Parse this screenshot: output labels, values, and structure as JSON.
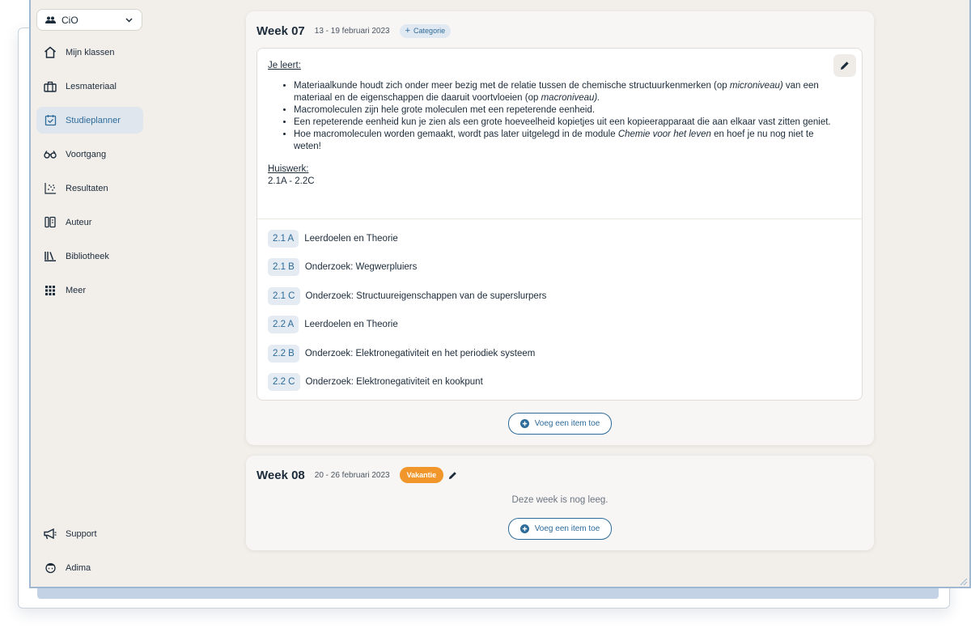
{
  "colors": {
    "accent": "#2d6b9a",
    "vacation": "#f0962a",
    "app_bg": "#f2efeb"
  },
  "sidebar": {
    "org_selector": {
      "label": "CiO",
      "icon": "people-icon"
    },
    "items": [
      {
        "label": "Mijn klassen",
        "icon": "home-icon"
      },
      {
        "label": "Lesmateriaal",
        "icon": "briefcase-icon"
      },
      {
        "label": "Studieplanner",
        "icon": "calendar-check-icon",
        "active": true
      },
      {
        "label": "Voortgang",
        "icon": "glasses-icon"
      },
      {
        "label": "Resultaten",
        "icon": "scatter-icon"
      },
      {
        "label": "Auteur",
        "icon": "book-author-icon"
      },
      {
        "label": "Bibliotheek",
        "icon": "library-icon"
      },
      {
        "label": "Meer",
        "icon": "grid-icon"
      }
    ],
    "bottom": [
      {
        "label": "Support",
        "icon": "megaphone-icon"
      },
      {
        "label": "Adima",
        "icon": "user-avatar-icon"
      }
    ]
  },
  "week07": {
    "title": "Week 07",
    "dates": "13 - 19 februari 2023",
    "category_label": "Categorie",
    "learn_heading": "Je leert:",
    "bullets": [
      [
        "Materiaalkunde houdt zich onder meer bezig met de relatie tussen de chemische structuurkenmerken (op ",
        "microniveau)",
        " van een materiaal en de eigenschappen die daaruit voortvloeien (op ",
        "macroniveau).",
        ""
      ],
      [
        "Macromoleculen zijn hele grote moleculen met een repeterende eenheid.",
        "",
        "",
        "",
        ""
      ],
      [
        "Een repeterende eenheid kun je zien als een grote hoeveelheid kopietjes uit een kopieerapparaat die aan elkaar vast zitten geniet.",
        "",
        "",
        "",
        ""
      ],
      [
        "Hoe macromoleculen worden gemaakt, wordt pas later uitgelegd in de module ",
        "Chemie voor het leven",
        " en hoef je nu nog niet te weten!",
        "",
        ""
      ]
    ],
    "homework_heading": "Huiswerk:",
    "homework_value": "2.1A - 2.2C",
    "items": [
      {
        "code": "2.1 A",
        "title": "Leerdoelen en Theorie"
      },
      {
        "code": "2.1 B",
        "title": "Onderzoek: Wegwerpluiers"
      },
      {
        "code": "2.1 C",
        "title": "Onderzoek: Structuureigenschappen van de superslurpers"
      },
      {
        "code": "2.2 A",
        "title": "Leerdoelen en Theorie"
      },
      {
        "code": "2.2 B",
        "title": "Onderzoek: Elektronegativiteit en het periodiek systeem"
      },
      {
        "code": "2.2 C",
        "title": "Onderzoek: Elektronegativiteit en kookpunt"
      }
    ],
    "add_label": "Voeg een item toe"
  },
  "week08": {
    "title": "Week 08",
    "dates": "20 - 26 februari 2023",
    "badge": "Vakantie",
    "empty_text": "Deze week is nog leeg.",
    "add_label": "Voeg een item toe"
  }
}
